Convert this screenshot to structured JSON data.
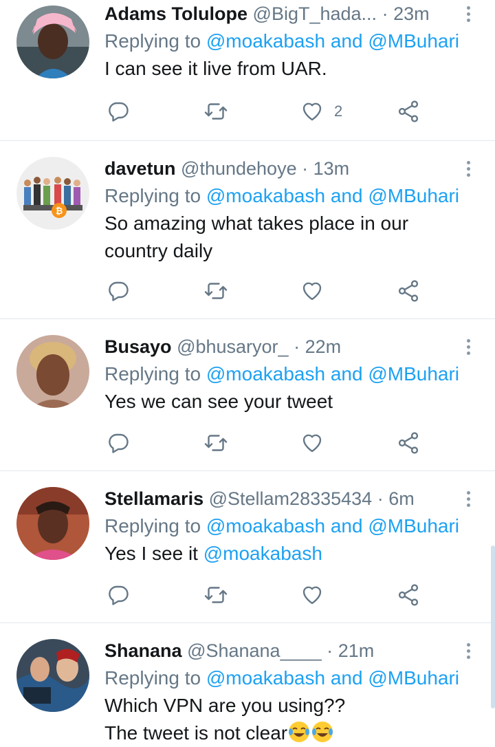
{
  "tweets": [
    {
      "name": "Adams Tolulope",
      "handle": "@BigT_hada...",
      "time": "23m",
      "replying_prefix": "Replying to",
      "mention_1": "@moakabash",
      "and": "and",
      "mention_2": "@MBuhari",
      "text_line_1": "I can see it live from UAR.",
      "text_line_2": "",
      "like_count": "2"
    },
    {
      "name": "davetun",
      "handle": "@thundehoye",
      "time": "13m",
      "replying_prefix": "Replying to",
      "mention_1": "@moakabash",
      "and": "and",
      "mention_2": "@MBuhari",
      "text_line_1": "So amazing what takes place in our",
      "text_line_2": "country daily",
      "like_count": ""
    },
    {
      "name": "Busayo",
      "handle": "@bhusaryor_",
      "time": "22m",
      "replying_prefix": "Replying to",
      "mention_1": "@moakabash",
      "and": "and",
      "mention_2": "@MBuhari",
      "text_line_1": "Yes we can see your tweet",
      "text_line_2": "",
      "like_count": ""
    },
    {
      "name": "Stellamaris",
      "handle": "@Stellam28335434",
      "time": "6m",
      "replying_prefix": "Replying to",
      "mention_1": "@moakabash",
      "and": "and",
      "mention_2": "@MBuhari",
      "text_line_1": "Yes I see it",
      "text_mention": "@moakabash",
      "text_line_2": "",
      "like_count": ""
    },
    {
      "name": "Shanana",
      "handle": "@Shanana____",
      "time": "21m",
      "replying_prefix": "Replying to",
      "mention_1": "@moakabash",
      "and": "and",
      "mention_2": "@MBuhari",
      "text_line_1": "Which VPN are you using??",
      "text_line_2": "The tweet is not clear",
      "like_count": ""
    }
  ],
  "separator": "·",
  "icons": {
    "reply": "reply-icon",
    "retweet": "retweet-icon",
    "like": "heart-icon",
    "share": "share-icon",
    "more": "more-vertical-icon"
  },
  "colors": {
    "link": "#1da1f2",
    "secondary_text": "#657786",
    "primary_text": "#14171a",
    "divider": "#e1e8ed"
  }
}
